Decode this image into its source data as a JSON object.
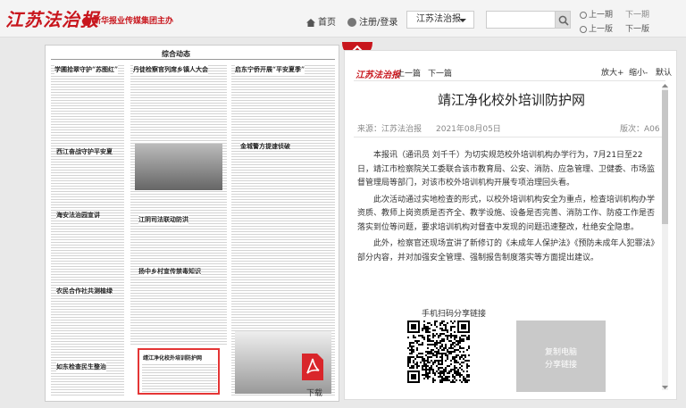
{
  "header": {
    "logo": "江苏法治报",
    "sublogo": "新华报业传媒集团主办",
    "home": "首页",
    "login": "注册/登录",
    "paper_select": "江苏法治报",
    "search_placeholder": "",
    "prev_period": "上一期",
    "next_period": "下一期",
    "prev_page": "上一版",
    "next_page": "下一版"
  },
  "newspaper": {
    "section": "综合动态",
    "headlines": [
      "学圃拾翠守护“苏图红”",
      "丹徒检察官列席乡镇人大会",
      "启东宁侨开展“平安夏季”",
      "西江奋战守护平安夏",
      "金城警方提速侦破",
      "海安法治园宣讲",
      "江阴司法联动防洪",
      "扬中乡村宣传禁毒知识",
      "农民合作社共测植绿",
      "如东检查民生整治",
      "靖江净化校外培训防护网"
    ],
    "download": "下载"
  },
  "article": {
    "logo": "江苏法治报",
    "prev": "上一篇",
    "next": "下一篇",
    "zoom_in": "放大+",
    "zoom_out": "缩小-",
    "zoom_default": "默认",
    "title": "靖江净化校外培训防护网",
    "source": "来源：江苏法治报",
    "date": "2021年08月05日",
    "edition": "版次：A06",
    "paragraphs": [
      "本报讯（通讯员 刘千千）为切实规范校外培训机构办学行为，7月21日至22日，靖江市检察院关工委联合该市教育局、公安、消防、应急管理、卫健委、市场监督管理局等部门，对该市校外培训机构开展专项治理回头看。",
      "此次活动通过实地检查的形式，以校外培训机构安全为重点，检查培训机构办学资质、教师上岗资质是否齐全、教学设施、设备是否完善、消防工作、防疫工作是否落实到位等问题，要求培训机构对督查中发现的问题迅速整改，杜绝安全隐患。",
      "此外，检察官还现场宣讲了新修订的《未成年人保护法》《预防未成年人犯罪法》部分内容，并对加强安全管理、强制报告制度落实等方面提出建议。"
    ],
    "share_label": "手机扫码分享链接",
    "copy_line1": "复制电脑",
    "copy_line2": "分享链接"
  },
  "colors": {
    "brand_red": "#c8161d",
    "highlight": "#e43535"
  }
}
